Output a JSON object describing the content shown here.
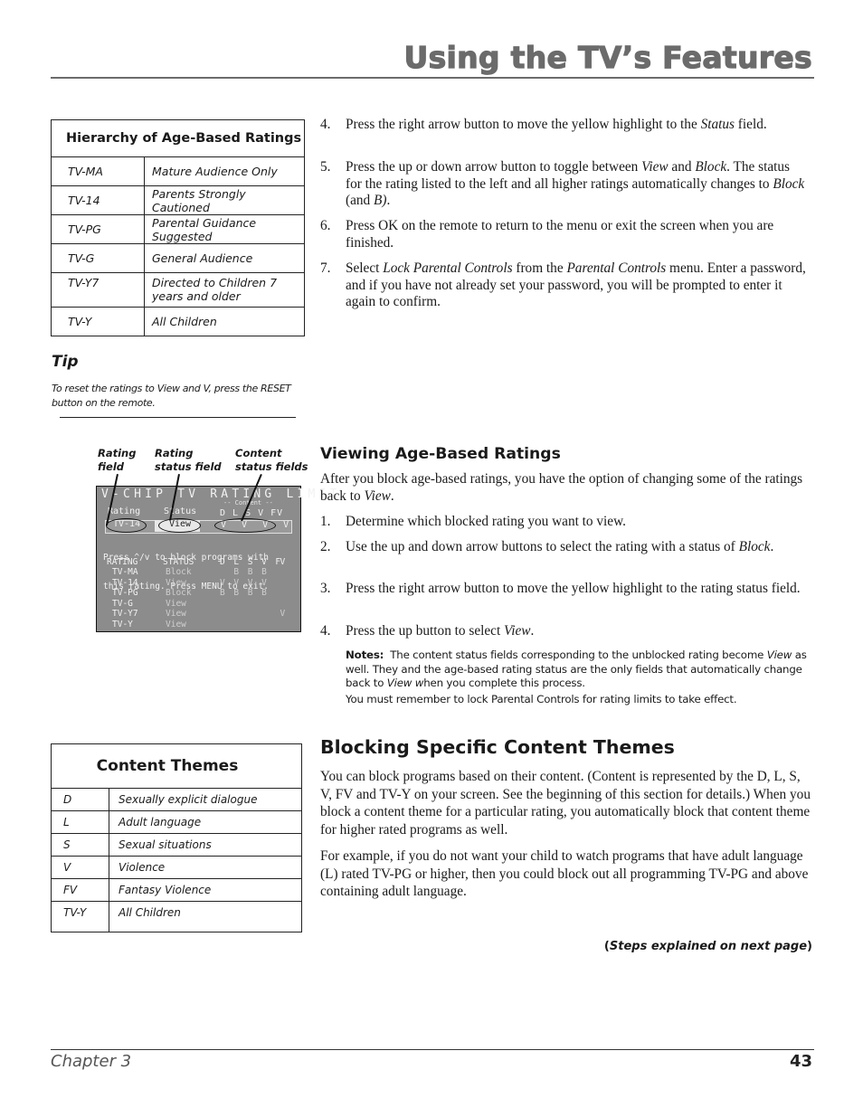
{
  "header": {
    "title": "Using the TV’s Features"
  },
  "hierarchy_table": {
    "title": "Hierarchy of Age-Based Ratings",
    "rows": [
      {
        "rating": "TV-MA",
        "description": "Mature Audience Only"
      },
      {
        "rating": "TV-14",
        "description": "Parents Strongly Cautioned"
      },
      {
        "rating": "TV-PG",
        "description": "Parental Guidance Suggested"
      },
      {
        "rating": "TV-G",
        "description": "General Audience"
      },
      {
        "rating": "TV-Y7",
        "description": "Directed to Children 7 years and older"
      },
      {
        "rating": "TV-Y",
        "description": "All Children"
      }
    ]
  },
  "tip": {
    "title": "Tip",
    "text": "To reset the ratings to View and V, press the RESET button on the remote."
  },
  "callouts": {
    "rating_field": [
      "Rating",
      "field"
    ],
    "rating_status_field": [
      "Rating",
      "status field"
    ],
    "content_status_fields": [
      "Content",
      "status fields"
    ]
  },
  "tv_screen": {
    "title": "V-CHIP TV RATING LIMIT",
    "content_label": "-- Content --",
    "rating_col_label": "Rating",
    "status_col_label": "Status",
    "content_cols": "D L S V FV",
    "selected": {
      "rating": "TV-14",
      "status": "View",
      "contents": "V V V V"
    },
    "instructions": [
      "Press ^/v to block programs with",
      "this rating. Press MENU to exit."
    ],
    "list_header": {
      "rating": "RATING",
      "status": "STATUS",
      "content": "D  L  S  V  FV"
    },
    "list": [
      {
        "rating": "TV-MA",
        "status": "Block",
        "content": "   B  B  B    "
      },
      {
        "rating": "TV-14",
        "status": "View",
        "content": "V  V  V  V    "
      },
      {
        "rating": "TV-PG",
        "status": "Block",
        "content": "B  B  B  B    "
      },
      {
        "rating": "TV-G",
        "status": "View",
        "content": "              "
      },
      {
        "rating": "TV-Y7",
        "status": "View",
        "content": "             V"
      },
      {
        "rating": "TV-Y",
        "status": "View",
        "content": "              "
      }
    ]
  },
  "steps_top": [
    {
      "num": "4.",
      "html_parts": [
        "Press the right arrow button to move the yellow highlight to the ",
        {
          "i": "Status"
        },
        " field."
      ]
    },
    {
      "num": "5.",
      "html_parts": [
        "Press the up or down arrow button to toggle between ",
        {
          "i": "View"
        },
        " and ",
        {
          "i": "Block"
        },
        ". The status for the rating listed to the left and all higher ratings automatically changes to ",
        {
          "i": "Block"
        },
        " (and ",
        {
          "i": "B)"
        },
        "."
      ]
    },
    {
      "num": "6.",
      "html_parts": [
        "Press OK on the remote to return to the menu or exit the screen when you are finished."
      ]
    },
    {
      "num": "7.",
      "html_parts": [
        "Select ",
        {
          "i": "Lock Parental Controls"
        },
        " from the ",
        {
          "i": "Parental Controls"
        },
        " menu. Enter a password, and if you have not already set your password, you will be prompted to enter it again to confirm."
      ]
    }
  ],
  "viewing_section": {
    "title": "Viewing Age-Based Ratings",
    "intro_parts": [
      "After you block age-based ratings, you have the option of changing some of the ratings back to ",
      {
        "i": "View"
      },
      "."
    ],
    "steps": [
      {
        "num": "1.",
        "html_parts": [
          "Determine which blocked rating you want to view."
        ]
      },
      {
        "num": "2.",
        "html_parts": [
          "Use the up and down arrow buttons to select the rating with a status of ",
          {
            "i": "Block"
          },
          "."
        ]
      },
      {
        "num": "3.",
        "html_parts": [
          "Press the right arrow button to move the yellow highlight to the rating status field."
        ]
      },
      {
        "num": "4.",
        "html_parts": [
          "Press the up button to select ",
          {
            "i": "View"
          },
          "."
        ]
      }
    ],
    "notes_label": "Notes:",
    "notes_parts": [
      "The content status fields corresponding to the unblocked rating become ",
      {
        "i": "View"
      },
      " as well. They and the age-based rating status are the only fields that automatically change back to ",
      {
        "i": "View w"
      },
      "hen you complete this process."
    ],
    "notes2": "You must remember to lock Parental Controls for rating limits to take effect."
  },
  "themes_table": {
    "title": "Content Themes",
    "rows": [
      {
        "code": "D",
        "description": "Sexually explicit dialogue"
      },
      {
        "code": "L",
        "description": "Adult language"
      },
      {
        "code": "S",
        "description": "Sexual situations"
      },
      {
        "code": "V",
        "description": "Violence"
      },
      {
        "code": "FV",
        "description": "Fantasy Violence"
      },
      {
        "code": "TV-Y",
        "description": "All Children"
      }
    ]
  },
  "blocking_section": {
    "title": "Blocking Specific Content Themes",
    "p1": "You can block programs based on their content. (Content is represented by the D, L, S, V, FV and TV-Y on your screen. See the beginning of this section for details.) When you block a content theme for a particular rating, you automatically block that content theme for higher rated programs as well.",
    "p2": "For example, if you do not want your child to watch programs that have adult language (L) rated TV-PG or higher, then you could block out all programming TV-PG and above containing adult language."
  },
  "next_page": {
    "open": "(",
    "text": "Steps explained on next page",
    "close": ")"
  },
  "footer": {
    "chapter": "Chapter 3",
    "page": "43"
  }
}
